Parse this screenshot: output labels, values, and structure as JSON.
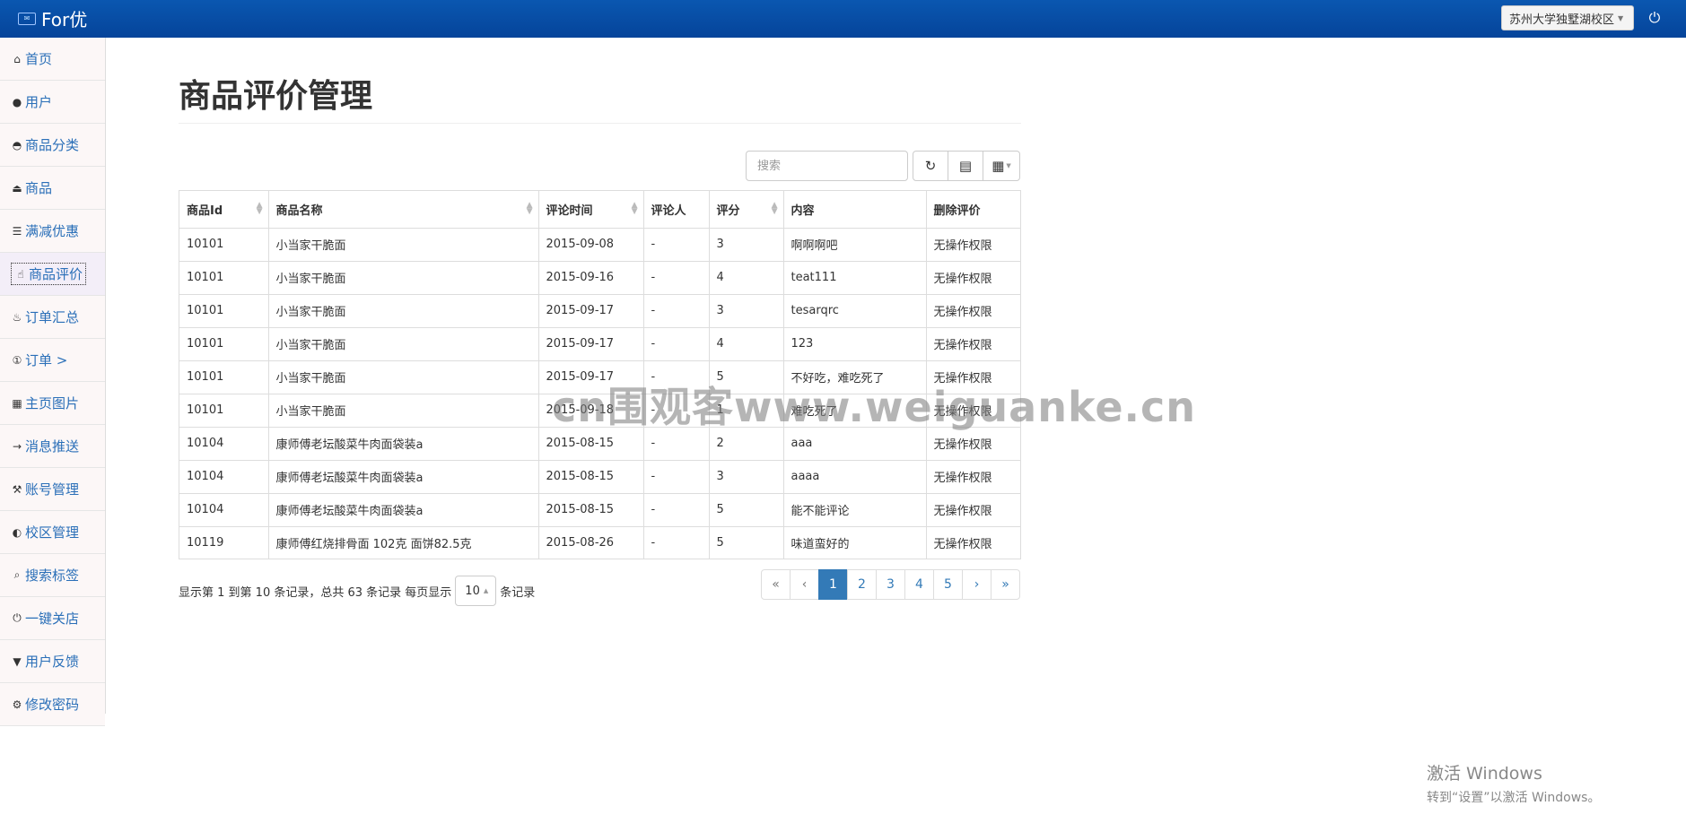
{
  "header": {
    "brand_icon": "✉",
    "brand": "For优",
    "campus_selected": "苏州大学独墅湖校区",
    "power_icon": "power-icon"
  },
  "sidebar": {
    "items": [
      {
        "icon": "⌂",
        "label": "首页"
      },
      {
        "icon": "●",
        "label": "用户"
      },
      {
        "icon": "◓",
        "label": "商品分类"
      },
      {
        "icon": "⏏",
        "label": "商品"
      },
      {
        "icon": "☰",
        "label": "满减优惠"
      },
      {
        "icon": "☝",
        "label": "商品评价"
      },
      {
        "icon": "♨",
        "label": "订单汇总"
      },
      {
        "icon": "①",
        "label": "订单 >"
      },
      {
        "icon": "▦",
        "label": "主页图片"
      },
      {
        "icon": "→",
        "label": "消息推送"
      },
      {
        "icon": "⚒",
        "label": "账号管理"
      },
      {
        "icon": "◐",
        "label": "校区管理"
      },
      {
        "icon": "⌕",
        "label": "搜索标签"
      },
      {
        "icon": "⏻",
        "label": "一键关店"
      },
      {
        "icon": "▼",
        "label": "用户反馈"
      },
      {
        "icon": "⚙",
        "label": "修改密码"
      }
    ],
    "active_index": 5
  },
  "main": {
    "title": "商品评价管理",
    "search_placeholder": "搜索",
    "toolbar": {
      "refresh_icon": "↻",
      "toggle_icon": "▤",
      "columns_icon": "▦"
    },
    "table": {
      "columns": [
        "商品Id",
        "商品名称",
        "评论时间",
        "评论人",
        "评分",
        "内容",
        "删除评价"
      ],
      "rows": [
        [
          "10101",
          "小当家干脆面",
          "2015-09-08",
          "-",
          "3",
          "啊啊啊吧",
          "无操作权限"
        ],
        [
          "10101",
          "小当家干脆面",
          "2015-09-16",
          "-",
          "4",
          "teat111",
          "无操作权限"
        ],
        [
          "10101",
          "小当家干脆面",
          "2015-09-17",
          "-",
          "3",
          "tesarqrc",
          "无操作权限"
        ],
        [
          "10101",
          "小当家干脆面",
          "2015-09-17",
          "-",
          "4",
          "123",
          "无操作权限"
        ],
        [
          "10101",
          "小当家干脆面",
          "2015-09-17",
          "-",
          "5",
          "不好吃，难吃死了",
          "无操作权限"
        ],
        [
          "10101",
          "小当家干脆面",
          "2015-09-18",
          "-",
          "1",
          "难吃死了",
          "无操作权限"
        ],
        [
          "10104",
          "康师傅老坛酸菜牛肉面袋装a",
          "2015-08-15",
          "-",
          "2",
          "aaa",
          "无操作权限"
        ],
        [
          "10104",
          "康师傅老坛酸菜牛肉面袋装a",
          "2015-08-15",
          "-",
          "3",
          "aaaa",
          "无操作权限"
        ],
        [
          "10104",
          "康师傅老坛酸菜牛肉面袋装a",
          "2015-08-15",
          "-",
          "5",
          "能不能评论",
          "无操作权限"
        ],
        [
          "10119",
          "康师傅红烧排骨面 102克 面饼82.5克",
          "2015-08-26",
          "-",
          "5",
          "味道蛮好的",
          "无操作权限"
        ]
      ]
    },
    "footer": {
      "info_before": "显示第 1 到第 10 条记录，总共 63 条记录 每页显示",
      "page_size": "10",
      "info_after": "条记录",
      "pages": [
        "«",
        "‹",
        "1",
        "2",
        "3",
        "4",
        "5",
        "›",
        "»"
      ],
      "current_page": "1"
    }
  },
  "overlay": {
    "watermark": "cn围观客www.weiguanke.cn",
    "activation_title": "激活 Windows",
    "activation_sub": "转到“设置”以激活 Windows。"
  }
}
